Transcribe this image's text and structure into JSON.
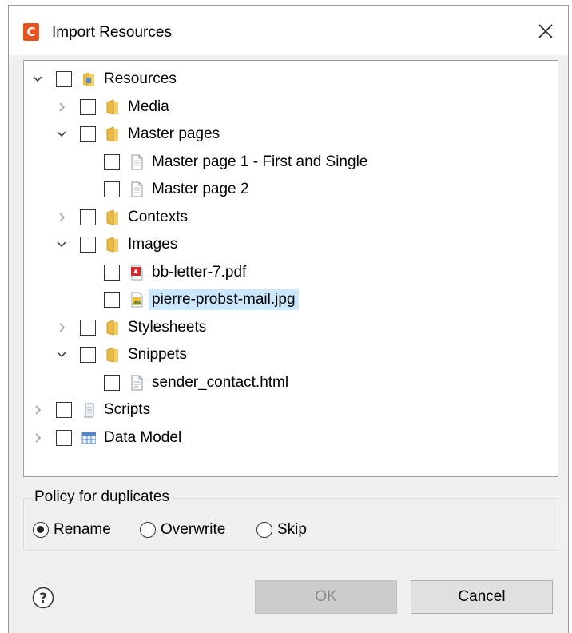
{
  "window": {
    "title": "Import Resources",
    "app_icon_letter": "C",
    "accent_color": "#e8531f"
  },
  "tree": {
    "items": [
      {
        "label": "Resources",
        "icon": "resources-folder-icon",
        "expander": "expanded",
        "checked": false
      },
      {
        "label": "Media",
        "icon": "folder-icon",
        "expander": "collapsed",
        "checked": false
      },
      {
        "label": "Master pages",
        "icon": "folder-icon",
        "expander": "expanded",
        "checked": false
      },
      {
        "label": "Master page 1 - First and Single",
        "icon": "page-icon",
        "expander": "none",
        "checked": false
      },
      {
        "label": "Master page 2",
        "icon": "page-icon",
        "expander": "none",
        "checked": false
      },
      {
        "label": "Contexts",
        "icon": "folder-icon",
        "expander": "collapsed",
        "checked": false
      },
      {
        "label": "Images",
        "icon": "folder-icon",
        "expander": "expanded",
        "checked": false
      },
      {
        "label": "bb-letter-7.pdf",
        "icon": "pdf-icon",
        "expander": "none",
        "checked": false
      },
      {
        "label": "pierre-probst-mail.jpg",
        "icon": "image-file-icon",
        "expander": "none",
        "checked": false,
        "selected": true
      },
      {
        "label": "Stylesheets",
        "icon": "folder-icon",
        "expander": "collapsed",
        "checked": false
      },
      {
        "label": "Snippets",
        "icon": "folder-icon",
        "expander": "expanded",
        "checked": false
      },
      {
        "label": "sender_contact.html",
        "icon": "html-file-icon",
        "expander": "none",
        "checked": false
      },
      {
        "label": "Scripts",
        "icon": "script-icon",
        "expander": "collapsed",
        "checked": false
      },
      {
        "label": "Data Model",
        "icon": "data-model-icon",
        "expander": "collapsed",
        "checked": false
      }
    ]
  },
  "policy": {
    "title": "Policy for duplicates",
    "options": [
      {
        "label": "Rename",
        "selected": true
      },
      {
        "label": "Overwrite",
        "selected": false
      },
      {
        "label": "Skip",
        "selected": false
      }
    ]
  },
  "buttons": {
    "ok_label": "OK",
    "ok_enabled": false,
    "cancel_label": "Cancel"
  }
}
